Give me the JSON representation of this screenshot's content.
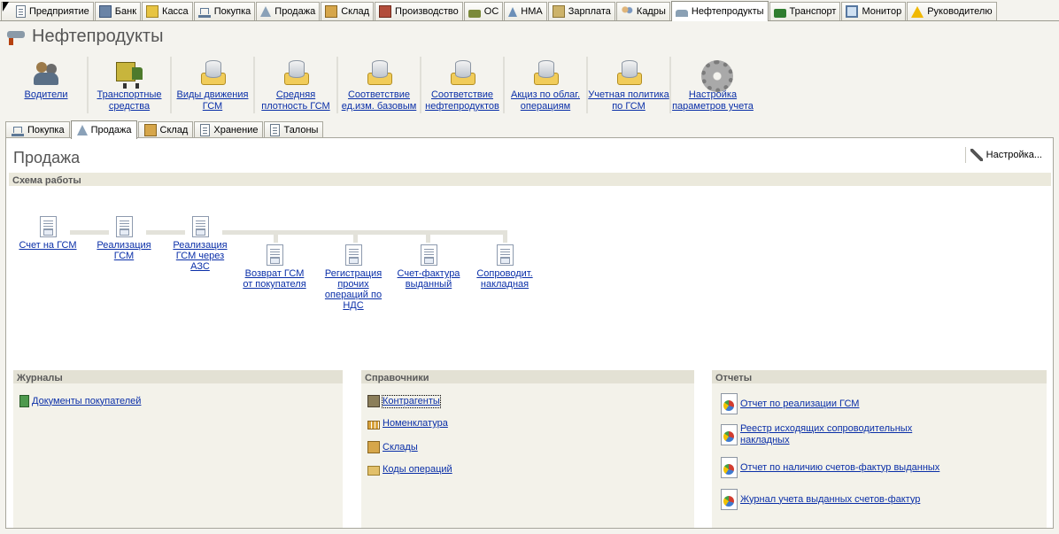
{
  "top_tabs": [
    {
      "label": "Предприятие",
      "icon": "enterprise-icon"
    },
    {
      "label": "Банк",
      "icon": "bank-icon"
    },
    {
      "label": "Касса",
      "icon": "cash-icon"
    },
    {
      "label": "Покупка",
      "icon": "purchase-icon"
    },
    {
      "label": "Продажа",
      "icon": "sale-icon"
    },
    {
      "label": "Склад",
      "icon": "warehouse-icon"
    },
    {
      "label": "Производство",
      "icon": "production-icon"
    },
    {
      "label": "ОС",
      "icon": "fixed-assets-icon"
    },
    {
      "label": "НМА",
      "icon": "intangibles-icon"
    },
    {
      "label": "Зарплата",
      "icon": "salary-icon"
    },
    {
      "label": "Кадры",
      "icon": "personnel-icon"
    },
    {
      "label": "Нефтепродукты",
      "icon": "oil-products-icon",
      "active": true
    },
    {
      "label": "Транспорт",
      "icon": "transport-icon"
    },
    {
      "label": "Монитор",
      "icon": "monitor-icon"
    },
    {
      "label": "Руководителю",
      "icon": "warning-icon"
    }
  ],
  "page_title": "Нефтепродукты",
  "quick_launch": [
    {
      "label": "Водители",
      "icon": "drivers-icon"
    },
    {
      "label": "Транспортные средства",
      "icon": "truck-icon"
    },
    {
      "label": "Виды движения ГСМ",
      "icon": "database-icon"
    },
    {
      "label": "Средняя плотность ГСМ",
      "icon": "database-icon"
    },
    {
      "label": "Соответствие ед.изм. базовым",
      "icon": "database-icon"
    },
    {
      "label": "Соответствие нефтепродуктов",
      "icon": "database-icon"
    },
    {
      "label": "Акциз по облаг. операциям",
      "icon": "database-icon"
    },
    {
      "label": "Учетная политика по ГСМ",
      "icon": "database-icon"
    },
    {
      "label": "Настройка параметров учета",
      "icon": "gear-icon"
    }
  ],
  "sub_tabs": [
    {
      "label": "Покупка",
      "icon": "purchase-icon"
    },
    {
      "label": "Продажа",
      "icon": "sale-icon",
      "active": true
    },
    {
      "label": "Склад",
      "icon": "warehouse-icon"
    },
    {
      "label": "Хранение",
      "icon": "storage-icon"
    },
    {
      "label": "Талоны",
      "icon": "coupons-icon"
    }
  ],
  "section_title": "Продажа",
  "settings_label": "Настройка...",
  "scheme": {
    "title": "Схема работы",
    "docs": [
      {
        "label": "Счет на ГСМ"
      },
      {
        "label": "Реализация ГСМ"
      },
      {
        "label": "Реализация ГСМ через АЗС"
      },
      {
        "label": "Возврат ГСМ от покупателя"
      },
      {
        "label": "Регистрация прочих операций по НДС"
      },
      {
        "label": "Счет-фактура выданный"
      },
      {
        "label": "Сопроводит. накладная"
      }
    ]
  },
  "journals": {
    "title": "Журналы",
    "items": [
      {
        "label": "Документы покупателей"
      }
    ]
  },
  "references": {
    "title": "Справочники",
    "items": [
      {
        "label": "Контрагенты"
      },
      {
        "label": "Номенклатура"
      },
      {
        "label": "Склады"
      },
      {
        "label": "Коды операций"
      }
    ]
  },
  "reports": {
    "title": "Отчеты",
    "items": [
      {
        "label": "Отчет по реализации ГСМ"
      },
      {
        "label": "Реестр исходящих сопроводительных накладных"
      },
      {
        "label": "Отчет по наличию счетов-фактур выданных"
      },
      {
        "label": "Журнал учета выданных счетов-фактур"
      }
    ]
  }
}
